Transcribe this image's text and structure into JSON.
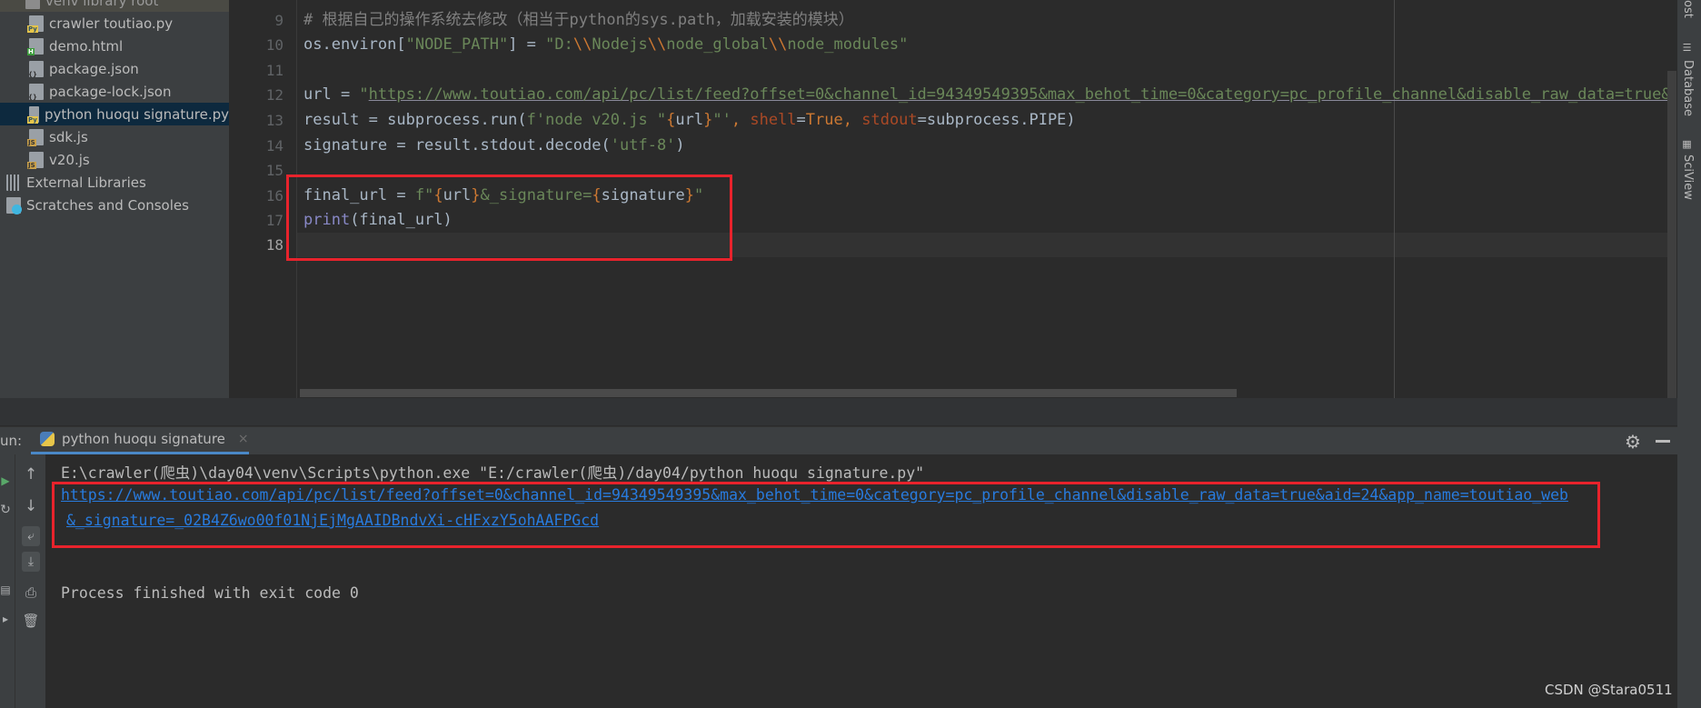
{
  "project_tree": {
    "items": [
      {
        "label": "venv  library root",
        "type": "folder"
      },
      {
        "label": "crawler toutiao.py",
        "type": "python"
      },
      {
        "label": "demo.html",
        "type": "html"
      },
      {
        "label": "package.json",
        "type": "json"
      },
      {
        "label": "package-lock.json",
        "type": "json"
      },
      {
        "label": "python huoqu signature.py",
        "type": "python",
        "selected": true
      },
      {
        "label": "sdk.js",
        "type": "js"
      },
      {
        "label": "v20.js",
        "type": "js"
      },
      {
        "label": "External Libraries",
        "type": "library"
      },
      {
        "label": "Scratches and Consoles",
        "type": "scratch"
      }
    ]
  },
  "editor": {
    "line_numbers": [
      "9",
      "10",
      "11",
      "12",
      "13",
      "14",
      "15",
      "16",
      "17",
      "18"
    ],
    "current_line": "18",
    "lines": {
      "l9": "# 根据自己的操作系统去修改（相当于python的sys.path，加载安装的模块）",
      "l10": {
        "a": "os.environ[",
        "b": "\"NODE_PATH\"",
        "c": "] = ",
        "d": "\"D:",
        "e": "\\\\",
        "f": "Nodejs",
        "g": "\\\\",
        "h": "node_global",
        "i": "\\\\",
        "j": "node_modules\""
      },
      "l12": {
        "a": "url = ",
        "b": "\"",
        "c": "https://www.toutiao.com/api/pc/list/feed?offset=0&channel_id=94349549395&max_behot_time=0&category=pc_profile_channel&disable_raw_data=true&aid="
      },
      "l13": {
        "a": "result = subprocess.run(",
        "b": "f'node v20.js \"",
        "c": "{",
        "d": "url",
        "e": "}",
        "f": "\"'",
        "g": ", ",
        "h": "shell",
        "i": "=",
        "j": "True",
        "k": ", ",
        "l": "stdout",
        "m": "=subprocess.PIPE)"
      },
      "l14": {
        "a": "signature = result.stdout.decode(",
        "b": "'utf-8'",
        "c": ")"
      },
      "l16": {
        "a": "final_url = ",
        "b": "f\"",
        "c": "{",
        "d": "url",
        "e": "}",
        "f": "&_signature=",
        "g": "{",
        "h": "signature",
        "i": "}",
        "j": "\""
      },
      "l17": {
        "a": "print",
        "b": "(final_url)"
      }
    }
  },
  "right_strip": {
    "items": [
      "ost",
      "Database",
      "SciView"
    ]
  },
  "run_panel": {
    "label": "un:",
    "tab_label": "python huoqu signature",
    "tab_close": "×",
    "settings_icon": "gear-icon",
    "console": {
      "command": "E:\\crawler(爬虫)\\day04\\venv\\Scripts\\python.exe \"E:/crawler(爬虫)/day04/python huoqu signature.py\"",
      "output_url_line1": "https://www.toutiao.com/api/pc/list/feed?offset=0&channel_id=94349549395&max_behot_time=0&category=pc_profile_channel&disable_raw_data=true&aid=24&app_name=toutiao_web",
      "output_url_line2": "&_signature=_02B4Z6wo00f01NjEjMgAAIDBndvXi-cHFxzY5ohAAFPGcd",
      "exit_message": "Process finished with exit code 0"
    }
  },
  "watermark": "CSDN @Stara0511",
  "colors": {
    "highlight_box": "#e8232c",
    "link": "#287bde",
    "selection": "#0d293e"
  }
}
